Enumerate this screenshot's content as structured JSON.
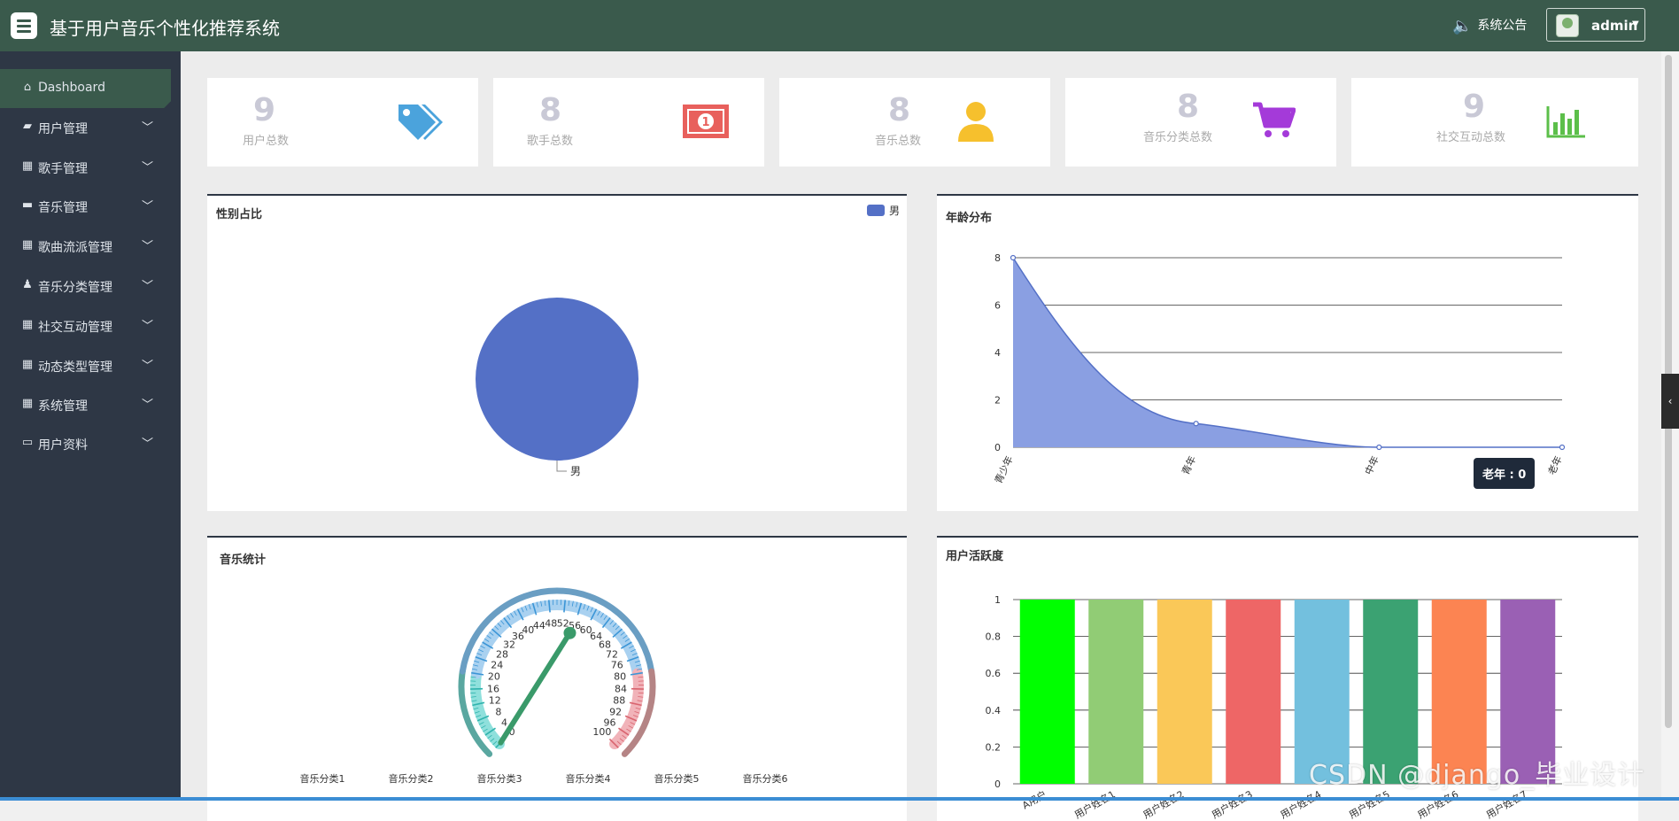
{
  "header": {
    "title": "基于用户音乐个性化推荐系统",
    "announcement": "系统公告",
    "user_name": "admin",
    "menu_icon": "hamburger-icon",
    "announce_icon": "speaker-icon"
  },
  "sidebar": {
    "items": [
      {
        "label": "Dashboard",
        "icon": "home-icon"
      },
      {
        "label": "用户管理",
        "icon": "users-icon"
      },
      {
        "label": "歌手管理",
        "icon": "grid-icon"
      },
      {
        "label": "音乐管理",
        "icon": "briefcase-icon"
      },
      {
        "label": "歌曲流派管理",
        "icon": "grid-icon"
      },
      {
        "label": "音乐分类管理",
        "icon": "person-icon"
      },
      {
        "label": "社交互动管理",
        "icon": "grid-icon"
      },
      {
        "label": "动态类型管理",
        "icon": "grid-icon"
      },
      {
        "label": "系统管理",
        "icon": "grid-icon"
      },
      {
        "label": "用户资料",
        "icon": "card-icon"
      }
    ]
  },
  "stats": [
    {
      "value": "9",
      "label": "用户总数",
      "icon": "price-tag-icon",
      "color": "#4ba3dc"
    },
    {
      "value": "8",
      "label": "歌手总数",
      "icon": "money-icon",
      "color": "#e8605c"
    },
    {
      "value": "8",
      "label": "音乐总数",
      "icon": "user-icon",
      "color": "#f6c02d"
    },
    {
      "value": "8",
      "label": "音乐分类总数",
      "icon": "cart-icon",
      "color": "#a43ad9"
    },
    {
      "value": "9",
      "label": "社交互动总数",
      "icon": "bar-chart-icon",
      "color": "#5cbf4a"
    }
  ],
  "colors": {
    "header": "#3a5a4c",
    "sidebar": "#2e3745",
    "pie": "#5470c6"
  },
  "chart_data": [
    {
      "type": "pie",
      "title": "性别占比",
      "legend": [
        "男"
      ],
      "legend_position": "top-right",
      "categories": [
        "男"
      ],
      "values": [
        9
      ]
    },
    {
      "type": "area",
      "title": "年龄分布",
      "categories": [
        "青少年",
        "青年",
        "中年",
        "老年"
      ],
      "values": [
        8,
        1,
        0,
        0
      ],
      "ylim": [
        0,
        8
      ],
      "yticks": [
        "0",
        "2",
        "4",
        "6",
        "8"
      ],
      "grid": true,
      "tooltip": "老年 : 0"
    },
    {
      "type": "gauge",
      "title": "音乐统计",
      "min": 0,
      "max": 100,
      "ticks": [
        "0",
        "4",
        "8",
        "12",
        "16",
        "20",
        "24",
        "28",
        "32",
        "36",
        "40",
        "44",
        "48",
        "52",
        "56",
        "60",
        "64",
        "68",
        "72",
        "76",
        "80",
        "84",
        "88",
        "92",
        "96",
        "100"
      ],
      "value": 55,
      "legend": [
        "音乐分类1",
        "音乐分类2",
        "音乐分类3",
        "音乐分类4",
        "音乐分类5",
        "音乐分类6"
      ]
    },
    {
      "type": "bar",
      "title": "用户活跃度",
      "categories": [
        "A用户",
        "用户姓名1",
        "用户姓名2",
        "用户姓名3",
        "用户姓名4",
        "用户姓名5",
        "用户姓名6",
        "用户姓名7"
      ],
      "values": [
        1,
        1,
        1,
        1,
        1,
        1,
        1,
        1
      ],
      "colors": [
        "#00ff00",
        "#91cc75",
        "#fac858",
        "#ee6666",
        "#73c0de",
        "#3ba272",
        "#fc8452",
        "#9a60b4"
      ],
      "ylim": [
        0,
        1
      ],
      "yticks": [
        "0",
        "0.2",
        "0.4",
        "0.6",
        "0.8",
        "1"
      ],
      "grid": true
    }
  ],
  "watermark": "CSDN @django_毕业设计"
}
